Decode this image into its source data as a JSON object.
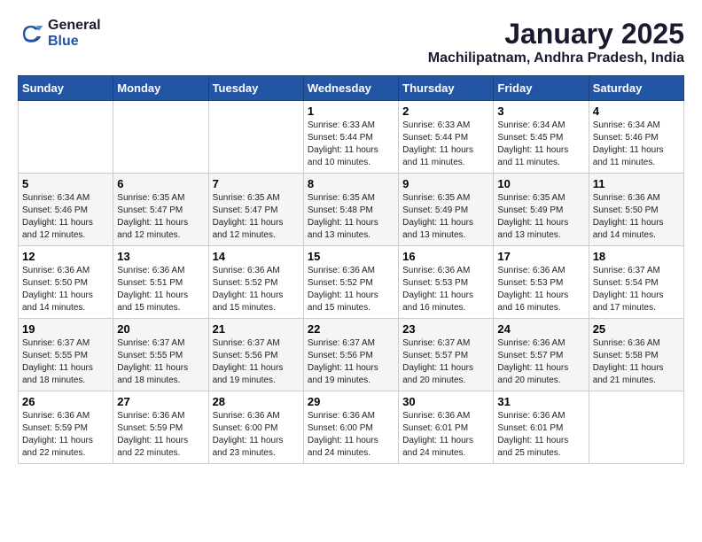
{
  "logo": {
    "line1": "General",
    "line2": "Blue"
  },
  "title": "January 2025",
  "subtitle": "Machilipatnam, Andhra Pradesh, India",
  "weekdays": [
    "Sunday",
    "Monday",
    "Tuesday",
    "Wednesday",
    "Thursday",
    "Friday",
    "Saturday"
  ],
  "weeks": [
    [
      {
        "day": "",
        "sunrise": "",
        "sunset": "",
        "daylight": ""
      },
      {
        "day": "",
        "sunrise": "",
        "sunset": "",
        "daylight": ""
      },
      {
        "day": "",
        "sunrise": "",
        "sunset": "",
        "daylight": ""
      },
      {
        "day": "1",
        "sunrise": "Sunrise: 6:33 AM",
        "sunset": "Sunset: 5:44 PM",
        "daylight": "Daylight: 11 hours and 10 minutes."
      },
      {
        "day": "2",
        "sunrise": "Sunrise: 6:33 AM",
        "sunset": "Sunset: 5:44 PM",
        "daylight": "Daylight: 11 hours and 11 minutes."
      },
      {
        "day": "3",
        "sunrise": "Sunrise: 6:34 AM",
        "sunset": "Sunset: 5:45 PM",
        "daylight": "Daylight: 11 hours and 11 minutes."
      },
      {
        "day": "4",
        "sunrise": "Sunrise: 6:34 AM",
        "sunset": "Sunset: 5:46 PM",
        "daylight": "Daylight: 11 hours and 11 minutes."
      }
    ],
    [
      {
        "day": "5",
        "sunrise": "Sunrise: 6:34 AM",
        "sunset": "Sunset: 5:46 PM",
        "daylight": "Daylight: 11 hours and 12 minutes."
      },
      {
        "day": "6",
        "sunrise": "Sunrise: 6:35 AM",
        "sunset": "Sunset: 5:47 PM",
        "daylight": "Daylight: 11 hours and 12 minutes."
      },
      {
        "day": "7",
        "sunrise": "Sunrise: 6:35 AM",
        "sunset": "Sunset: 5:47 PM",
        "daylight": "Daylight: 11 hours and 12 minutes."
      },
      {
        "day": "8",
        "sunrise": "Sunrise: 6:35 AM",
        "sunset": "Sunset: 5:48 PM",
        "daylight": "Daylight: 11 hours and 13 minutes."
      },
      {
        "day": "9",
        "sunrise": "Sunrise: 6:35 AM",
        "sunset": "Sunset: 5:49 PM",
        "daylight": "Daylight: 11 hours and 13 minutes."
      },
      {
        "day": "10",
        "sunrise": "Sunrise: 6:35 AM",
        "sunset": "Sunset: 5:49 PM",
        "daylight": "Daylight: 11 hours and 13 minutes."
      },
      {
        "day": "11",
        "sunrise": "Sunrise: 6:36 AM",
        "sunset": "Sunset: 5:50 PM",
        "daylight": "Daylight: 11 hours and 14 minutes."
      }
    ],
    [
      {
        "day": "12",
        "sunrise": "Sunrise: 6:36 AM",
        "sunset": "Sunset: 5:50 PM",
        "daylight": "Daylight: 11 hours and 14 minutes."
      },
      {
        "day": "13",
        "sunrise": "Sunrise: 6:36 AM",
        "sunset": "Sunset: 5:51 PM",
        "daylight": "Daylight: 11 hours and 15 minutes."
      },
      {
        "day": "14",
        "sunrise": "Sunrise: 6:36 AM",
        "sunset": "Sunset: 5:52 PM",
        "daylight": "Daylight: 11 hours and 15 minutes."
      },
      {
        "day": "15",
        "sunrise": "Sunrise: 6:36 AM",
        "sunset": "Sunset: 5:52 PM",
        "daylight": "Daylight: 11 hours and 15 minutes."
      },
      {
        "day": "16",
        "sunrise": "Sunrise: 6:36 AM",
        "sunset": "Sunset: 5:53 PM",
        "daylight": "Daylight: 11 hours and 16 minutes."
      },
      {
        "day": "17",
        "sunrise": "Sunrise: 6:36 AM",
        "sunset": "Sunset: 5:53 PM",
        "daylight": "Daylight: 11 hours and 16 minutes."
      },
      {
        "day": "18",
        "sunrise": "Sunrise: 6:37 AM",
        "sunset": "Sunset: 5:54 PM",
        "daylight": "Daylight: 11 hours and 17 minutes."
      }
    ],
    [
      {
        "day": "19",
        "sunrise": "Sunrise: 6:37 AM",
        "sunset": "Sunset: 5:55 PM",
        "daylight": "Daylight: 11 hours and 18 minutes."
      },
      {
        "day": "20",
        "sunrise": "Sunrise: 6:37 AM",
        "sunset": "Sunset: 5:55 PM",
        "daylight": "Daylight: 11 hours and 18 minutes."
      },
      {
        "day": "21",
        "sunrise": "Sunrise: 6:37 AM",
        "sunset": "Sunset: 5:56 PM",
        "daylight": "Daylight: 11 hours and 19 minutes."
      },
      {
        "day": "22",
        "sunrise": "Sunrise: 6:37 AM",
        "sunset": "Sunset: 5:56 PM",
        "daylight": "Daylight: 11 hours and 19 minutes."
      },
      {
        "day": "23",
        "sunrise": "Sunrise: 6:37 AM",
        "sunset": "Sunset: 5:57 PM",
        "daylight": "Daylight: 11 hours and 20 minutes."
      },
      {
        "day": "24",
        "sunrise": "Sunrise: 6:36 AM",
        "sunset": "Sunset: 5:57 PM",
        "daylight": "Daylight: 11 hours and 20 minutes."
      },
      {
        "day": "25",
        "sunrise": "Sunrise: 6:36 AM",
        "sunset": "Sunset: 5:58 PM",
        "daylight": "Daylight: 11 hours and 21 minutes."
      }
    ],
    [
      {
        "day": "26",
        "sunrise": "Sunrise: 6:36 AM",
        "sunset": "Sunset: 5:59 PM",
        "daylight": "Daylight: 11 hours and 22 minutes."
      },
      {
        "day": "27",
        "sunrise": "Sunrise: 6:36 AM",
        "sunset": "Sunset: 5:59 PM",
        "daylight": "Daylight: 11 hours and 22 minutes."
      },
      {
        "day": "28",
        "sunrise": "Sunrise: 6:36 AM",
        "sunset": "Sunset: 6:00 PM",
        "daylight": "Daylight: 11 hours and 23 minutes."
      },
      {
        "day": "29",
        "sunrise": "Sunrise: 6:36 AM",
        "sunset": "Sunset: 6:00 PM",
        "daylight": "Daylight: 11 hours and 24 minutes."
      },
      {
        "day": "30",
        "sunrise": "Sunrise: 6:36 AM",
        "sunset": "Sunset: 6:01 PM",
        "daylight": "Daylight: 11 hours and 24 minutes."
      },
      {
        "day": "31",
        "sunrise": "Sunrise: 6:36 AM",
        "sunset": "Sunset: 6:01 PM",
        "daylight": "Daylight: 11 hours and 25 minutes."
      },
      {
        "day": "",
        "sunrise": "",
        "sunset": "",
        "daylight": ""
      }
    ]
  ]
}
